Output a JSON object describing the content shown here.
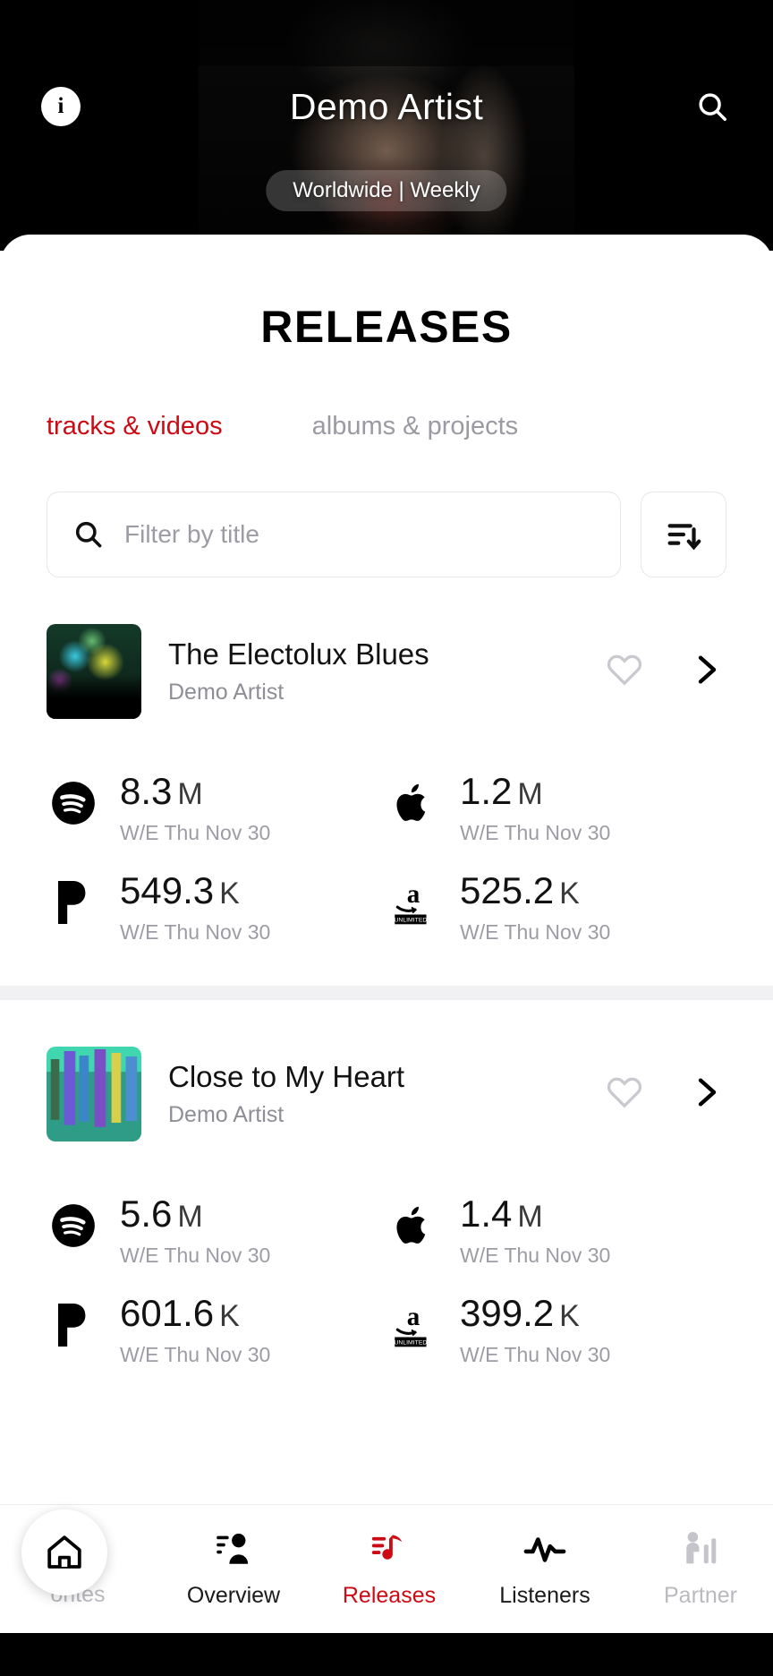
{
  "header": {
    "info_icon": "info-icon",
    "title": "Demo Artist",
    "search_icon": "search-icon",
    "scope_pill": "Worldwide | Weekly"
  },
  "page": {
    "title": "RELEASES",
    "tabs": [
      {
        "label": "tracks & videos",
        "active": true
      },
      {
        "label": "albums & projects",
        "active": false
      }
    ],
    "accent_color": "#cc0a14",
    "muted_color": "#9a9aa2"
  },
  "filter": {
    "placeholder": "Filter by title",
    "value": "",
    "search_icon": "search-icon",
    "sort_icon": "sort-descending-icon"
  },
  "releases": [
    {
      "title": "The Electolux Blues",
      "artist": "Demo Artist",
      "artwork": "concert-crowd-artwork",
      "favorite_icon": "heart-outline-icon",
      "chevron_icon": "chevron-right-icon",
      "stats": [
        {
          "platform": "spotify",
          "value": "8.3",
          "unit": "M",
          "period": "W/E Thu Nov 30"
        },
        {
          "platform": "apple-music",
          "value": "1.2",
          "unit": "M",
          "period": "W/E Thu Nov 30"
        },
        {
          "platform": "pandora",
          "value": "549.3",
          "unit": "K",
          "period": "W/E Thu Nov 30"
        },
        {
          "platform": "amazon-unlimited",
          "value": "525.2",
          "unit": "K",
          "period": "W/E Thu Nov 30"
        }
      ]
    },
    {
      "title": "Close to My Heart",
      "artist": "Demo Artist",
      "artwork": "city-skyline-artwork",
      "favorite_icon": "heart-outline-icon",
      "chevron_icon": "chevron-right-icon",
      "stats": [
        {
          "platform": "spotify",
          "value": "5.6",
          "unit": "M",
          "period": "W/E Thu Nov 30"
        },
        {
          "platform": "apple-music",
          "value": "1.4",
          "unit": "M",
          "period": "W/E Thu Nov 30"
        },
        {
          "platform": "pandora",
          "value": "601.6",
          "unit": "K",
          "period": "W/E Thu Nov 30"
        },
        {
          "platform": "amazon-unlimited",
          "value": "399.2",
          "unit": "K",
          "period": "W/E Thu Nov 30"
        }
      ]
    }
  ],
  "bottom_nav": {
    "home_fab_icon": "home-icon",
    "items": [
      {
        "label": "orites",
        "icon": "heart-outline-icon",
        "active": false,
        "clipped": true
      },
      {
        "label": "Overview",
        "icon": "person-list-icon",
        "active": false
      },
      {
        "label": "Releases",
        "icon": "music-note-lines-icon",
        "active": true
      },
      {
        "label": "Listeners",
        "icon": "pulse-wave-icon",
        "active": false
      },
      {
        "label": "Partner",
        "icon": "person-chart-icon",
        "active": false,
        "clipped": true
      }
    ]
  }
}
